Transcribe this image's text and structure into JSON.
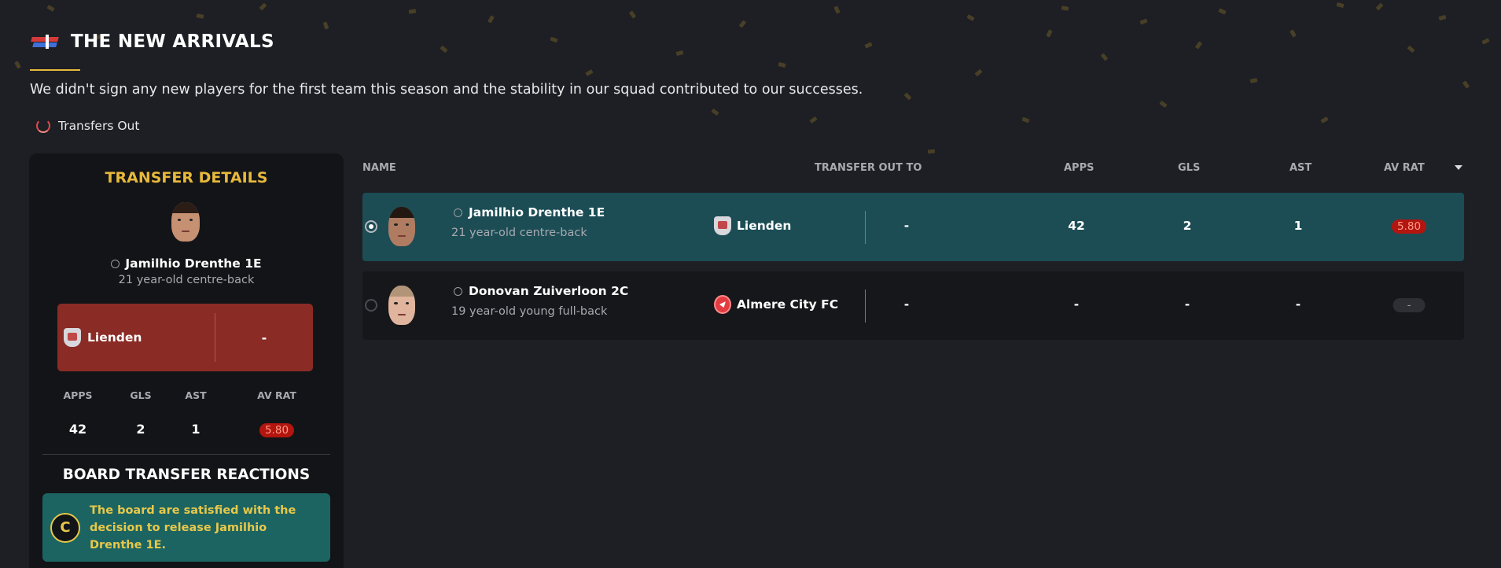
{
  "header": {
    "title": "THE NEW ARRIVALS",
    "subtitle": "We didn't sign any new players for the first team this season and the stability in our squad contributed to our successes."
  },
  "tab": {
    "label": "Transfers Out",
    "icon": "cycle-icon"
  },
  "transfer_details": {
    "title": "TRANSFER DETAILS",
    "player_name": "Jamilhio Drenthe 1E",
    "player_desc": "21 year-old centre-back",
    "club": "Lienden",
    "fee": "-",
    "stats_headers": {
      "apps": "APPS",
      "gls": "GLS",
      "ast": "AST",
      "av_rat": "AV RAT"
    },
    "stats_values": {
      "apps": "42",
      "gls": "2",
      "ast": "1",
      "av_rat": "5.80"
    }
  },
  "board": {
    "title": "BOARD TRANSFER REACTIONS",
    "badge": "C",
    "message": "The board are satisfied with the decision to release Jamilhio Drenthe 1E."
  },
  "table": {
    "headers": {
      "name": "NAME",
      "transfer_out_to": "TRANSFER OUT TO",
      "apps": "APPS",
      "gls": "GLS",
      "ast": "AST",
      "av_rat": "AV RAT"
    },
    "rows": [
      {
        "name": "Jamilhio Drenthe 1E",
        "desc": "21 year-old centre-back",
        "club": "Lienden",
        "fee": "-",
        "apps": "42",
        "gls": "2",
        "ast": "1",
        "av_rat": "5.80",
        "selected": true
      },
      {
        "name": "Donovan Zuiverloon 2C",
        "desc": "19 year-old young full-back",
        "club": "Almere City FC",
        "fee": "-",
        "apps": "-",
        "gls": "-",
        "ast": "-",
        "av_rat": "-",
        "selected": false
      }
    ]
  },
  "colors": {
    "background": "#1e1f24",
    "accent_gold": "#e7b93b",
    "selected_row": "#1c4d55",
    "club_box": "#8a2b26",
    "board_box": "#1c6462",
    "rating_red": "#b3150f"
  }
}
